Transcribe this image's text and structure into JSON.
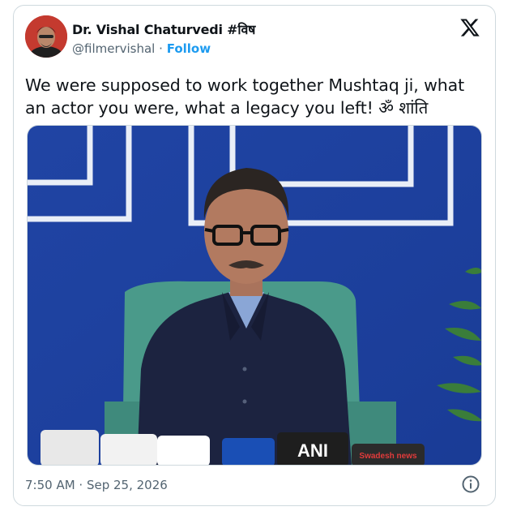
{
  "author": {
    "name": "Dr. Vishal Chaturvedi #विष",
    "handle": "@filmervishal",
    "separator": "·",
    "follow_label": "Follow"
  },
  "tweet": {
    "text": "We were supposed to work together Mushtaq ji, what an actor you were, what a legacy you left! ॐ शांति"
  },
  "media": {
    "mic_labels": [
      "ANI",
      "Swadesh news"
    ]
  },
  "meta": {
    "timestamp": "7:50 AM · Sep 25, 2026"
  },
  "icons": {
    "platform": "x-logo-icon",
    "info": "info-icon"
  },
  "colors": {
    "accent": "#1d9bf0",
    "secondary_text": "#536471",
    "wall_blue": "#2247a8"
  }
}
